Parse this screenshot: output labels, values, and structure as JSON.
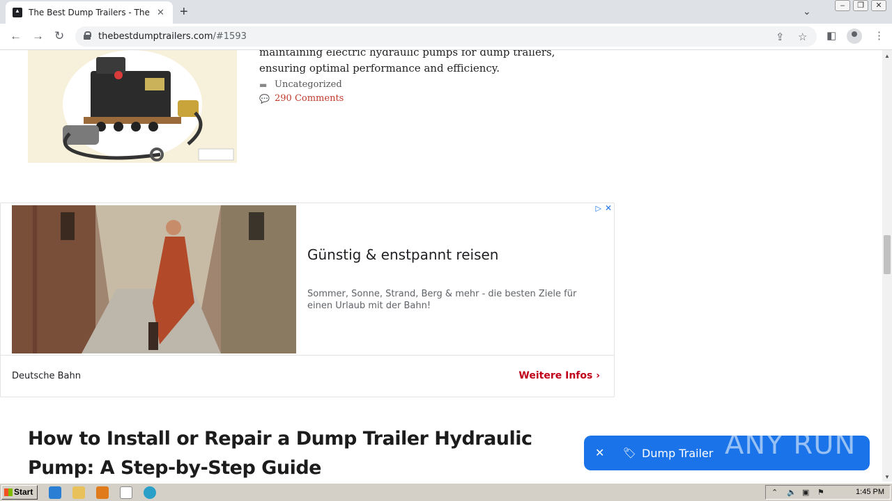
{
  "browser": {
    "tab_title": "The Best Dump Trailers - The best du",
    "url_host": "thebestdumptrailers.com",
    "url_path": "/#1593"
  },
  "post": {
    "excerpt_lines": [
      "maintaining electric hydraulic pumps for dump trailers,",
      "ensuring optimal performance and efficiency."
    ],
    "category": "Uncategorized",
    "comments": "290 Comments"
  },
  "ad": {
    "headline": "Günstig & enstpannt reisen",
    "description": "Sommer, Sonne, Strand, Berg & mehr - die besten Ziele für einen Urlaub mit der Bahn!",
    "advertiser": "Deutsche Bahn",
    "cta": "Weitere Infos"
  },
  "article": {
    "title": "How to Install or Repair a Dump Trailer Hydraulic Pump: A Step-by-Step Guide"
  },
  "chip": {
    "label": "Dump Trailer"
  },
  "watermark": "ANY RUN",
  "taskbar": {
    "start_label": "Start",
    "time": "1:45 PM"
  }
}
